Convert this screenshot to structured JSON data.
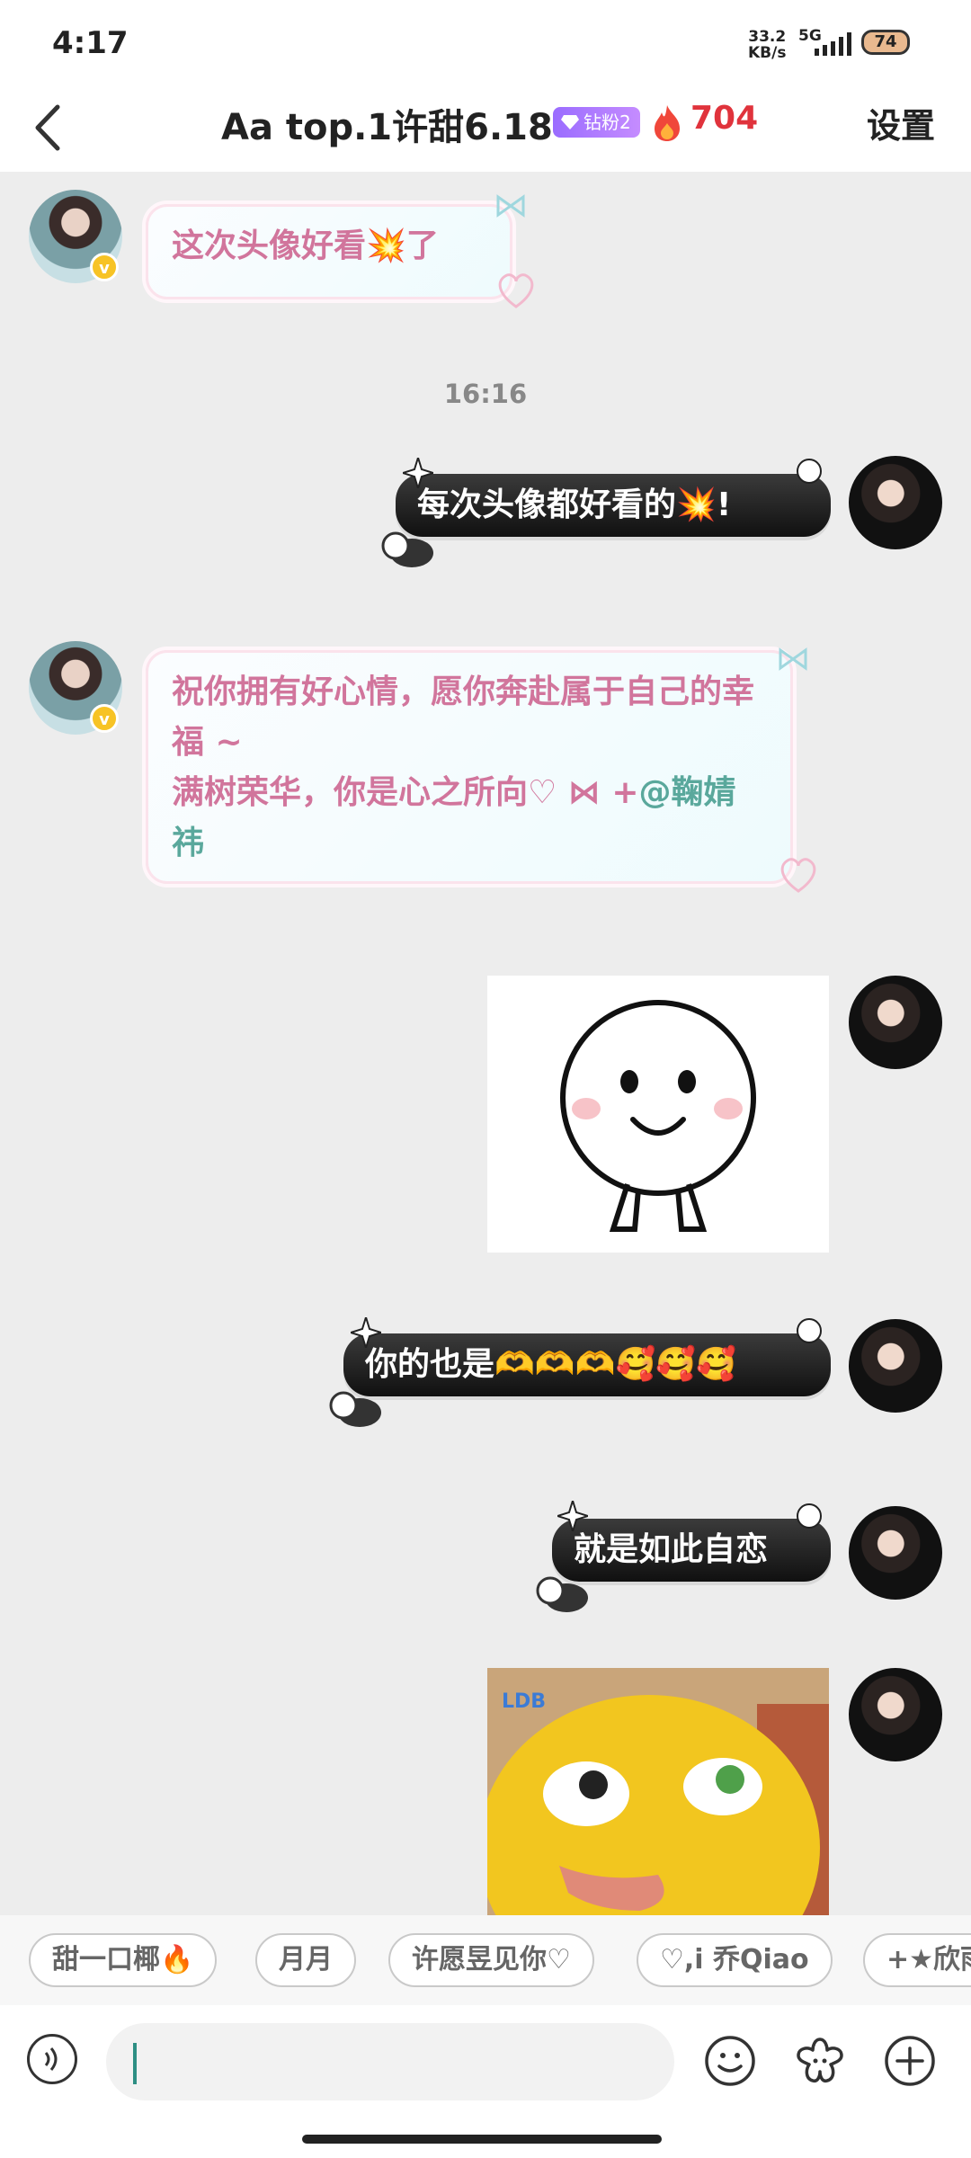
{
  "status_bar": {
    "time": "4:17",
    "net_speed_value": "33.2",
    "net_speed_unit": "KB/s",
    "network_type": "5G",
    "battery": "74"
  },
  "header": {
    "title": "Aa top.1许甜6.18",
    "fan_badge": "钻粉2",
    "heat_count": "704",
    "settings_label": "设置"
  },
  "messages": [
    {
      "side": "left",
      "type": "text",
      "text": "这次头像好看💥了"
    },
    {
      "type": "timestamp",
      "text": "16:16"
    },
    {
      "side": "right",
      "type": "text",
      "text": "每次头像都好看的💥!"
    },
    {
      "side": "left",
      "type": "text",
      "lines": [
        "祝你拥有好心情，愿你奔赴属于自己的幸福 ~",
        "满树荣华，你是心之所向♡ ⋈ +"
      ],
      "mention": "@鞠婧祎"
    },
    {
      "side": "right",
      "type": "sticker",
      "sticker": "smiling-face-sticker"
    },
    {
      "side": "right",
      "type": "text",
      "text": "你的也是🫶🫶🫶🥰🥰🥰"
    },
    {
      "side": "right",
      "type": "text",
      "text": "就是如此自恋"
    },
    {
      "side": "right",
      "type": "sticker",
      "sticker": "yellow-duck-sticker",
      "sticker_label": "LDB"
    }
  ],
  "quick_chips": [
    "甜一口椰🔥",
    "月月",
    "许愿昱见你♡",
    "♡,i 乔Qiao",
    "+★欣雨"
  ],
  "input": {
    "value": "",
    "placeholder": ""
  },
  "icons": {
    "back": "chevron-left-icon",
    "voice": "voice-icon",
    "emoji": "emoji-icon",
    "sticker": "flower-sticker-icon",
    "add": "plus-circle-icon"
  },
  "colors": {
    "pink_text": "#d1759c",
    "mention_teal": "#5aa89c",
    "heat_red": "#e0333c",
    "badge_purple": "#9a6cff"
  }
}
